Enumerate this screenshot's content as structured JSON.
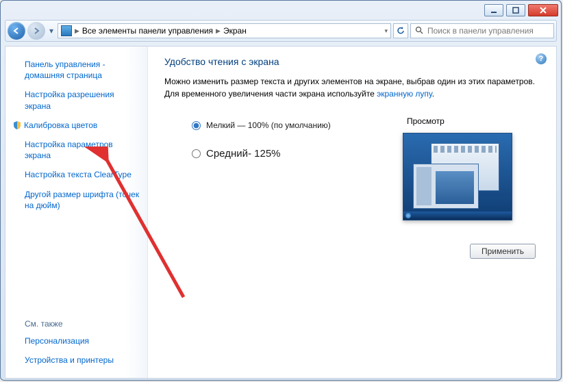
{
  "breadcrumb": {
    "item1": "Все элементы панели управления",
    "item2": "Экран"
  },
  "search": {
    "placeholder": "Поиск в панели управления"
  },
  "sidebar": {
    "items": [
      "Панель управления - домашняя страница",
      "Настройка разрешения экрана",
      "Калибровка цветов",
      "Настройка параметров экрана",
      "Настройка текста ClearType",
      "Другой размер шрифта (точек на дюйм)"
    ],
    "footer_hdr": "См. также",
    "footer_items": [
      "Персонализация",
      "Устройства и принтеры"
    ]
  },
  "main": {
    "heading": "Удобство чтения с экрана",
    "desc_pre": "Можно изменить размер текста и других элементов на экране, выбрав один из этих параметров. Для временного увеличения части экрана используйте ",
    "desc_link": "экранную лупу",
    "desc_post": ".",
    "options": [
      {
        "label": "Мелкий — 100% (по умолчанию)",
        "checked": true
      },
      {
        "label": "Средний- 125%",
        "checked": false
      }
    ],
    "preview_label": "Просмотр",
    "apply": "Применить"
  }
}
